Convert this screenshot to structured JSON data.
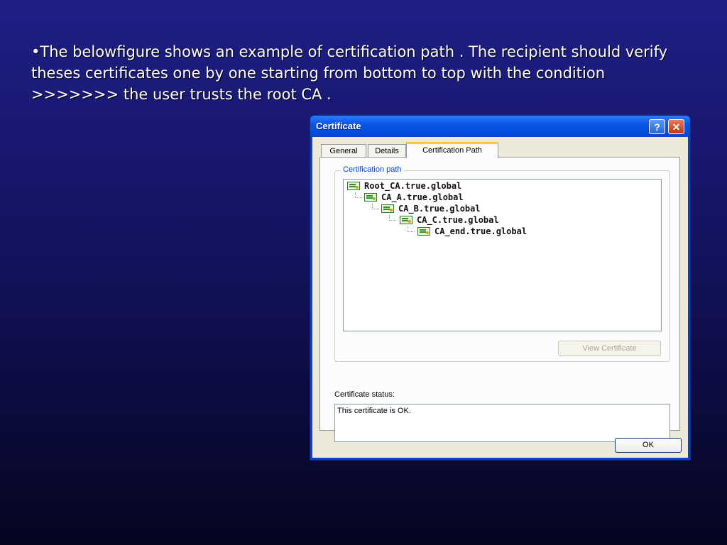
{
  "slide": {
    "text": "•The belowfigure shows an example of certification path . The recipient should verify theses certificates one by one starting from bottom to top with the condition >>>>>>> the user trusts the root CA ."
  },
  "dialog": {
    "title": "Certificate",
    "help_label": "?",
    "close_label": "✕",
    "tabs": [
      {
        "label": "General"
      },
      {
        "label": "Details"
      },
      {
        "label": "Certification Path"
      }
    ],
    "group_label": "Certification path",
    "tree": [
      {
        "label": "Root_CA.true.global",
        "level": 0
      },
      {
        "label": "CA_A.true.global",
        "level": 1
      },
      {
        "label": "CA_B.true.global",
        "level": 2
      },
      {
        "label": "CA_C.true.global",
        "level": 3
      },
      {
        "label": "CA_end.true.global",
        "level": 4
      }
    ],
    "view_certificate_label": "View Certificate",
    "status_label": "Certificate status:",
    "status_text": "This certificate is OK.",
    "ok_label": "OK"
  },
  "icons": {
    "certificate": "certificate-icon",
    "help": "help-icon",
    "close": "close-icon"
  }
}
